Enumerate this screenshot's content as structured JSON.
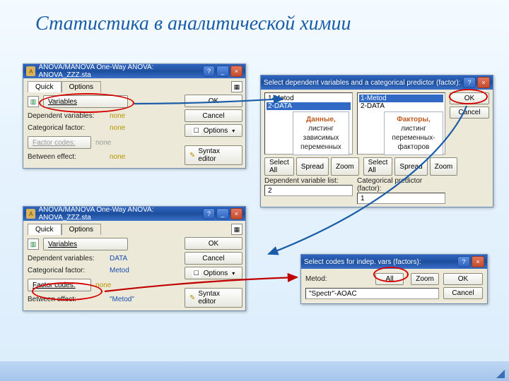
{
  "slide": {
    "title": "Статистика в аналитической химии"
  },
  "anova1": {
    "title": "ANOVA/MANOVA One-Way ANOVA: ANOVA_ZZZ.sta",
    "tabs": {
      "quick": "Quick",
      "options": "Options"
    },
    "variables_btn": "Variables",
    "dep_label": "Dependent variables:",
    "dep_value": "none",
    "cat_label": "Categorical factor:",
    "cat_value": "none",
    "codes_btn": "Factor codes:",
    "codes_value": "none",
    "between_label": "Between effect:",
    "between_value": "none",
    "ok": "OK",
    "cancel": "Cancel",
    "options_btn": "Options",
    "syntax": "Syntax editor"
  },
  "anova2": {
    "title": "ANOVA/MANOVA One-Way ANOVA: ANOVA_ZZZ.sta",
    "tabs": {
      "quick": "Quick",
      "options": "Options"
    },
    "variables_btn": "Variables",
    "dep_label": "Dependent variables:",
    "dep_value": "DATA",
    "cat_label": "Categorical factor:",
    "cat_value": "Metod",
    "codes_btn": "Factor codes:",
    "codes_value": "none",
    "between_label": "Between effect:",
    "between_value": "\"Metod\"",
    "ok": "OK",
    "cancel": "Cancel",
    "options_btn": "Options",
    "syntax": "Syntax editor"
  },
  "seldep": {
    "title": "Select dependent variables and a categorical predictor (factor):",
    "list1": {
      "items": [
        "1-Metod",
        "2-DATA"
      ],
      "selected": 1
    },
    "list2": {
      "items": [
        "1-Metod",
        "2-DATA"
      ],
      "selected": 0
    },
    "selectall": "Select All",
    "spread": "Spread",
    "zoom": "Zoom",
    "deplist_label": "Dependent variable list:",
    "deplist_value": "2",
    "catpred_label": "Categorical predictor (factor):",
    "catpred_value": "1",
    "ok": "OK",
    "cancel": "Cancel"
  },
  "selcodes": {
    "title": "Select codes for indep. vars (factors):",
    "var_label": "Metod:",
    "all_btn": "All",
    "zoom": "Zoom",
    "value": "\"Spectr\"-AOAC",
    "ok": "OK",
    "cancel": "Cancel"
  },
  "callouts": {
    "data": {
      "title": "Данные,",
      "l2": "листинг",
      "l3": "зависимых",
      "l4": "переменных"
    },
    "fact": {
      "title": "Факторы,",
      "l2": "листинг",
      "l3": "переменных-",
      "l4": "факторов"
    }
  }
}
